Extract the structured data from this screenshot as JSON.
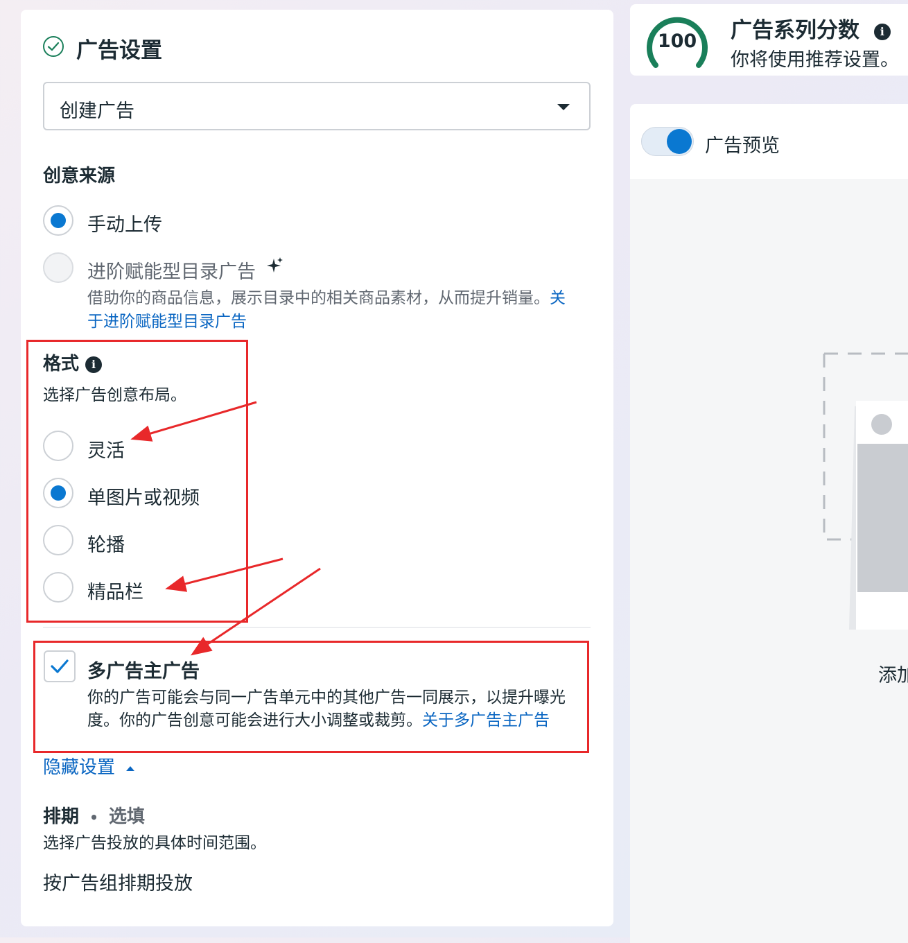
{
  "ad_settings": {
    "title": "广告设置",
    "create_select": {
      "value": "创建广告"
    },
    "creative_source": {
      "heading": "创意来源",
      "options": [
        {
          "label": "手动上传",
          "checked": true
        },
        {
          "label": "进阶赋能型目录广告",
          "checked": false,
          "description": "借助你的商品信息，展示目录中的相关商品素材，从而提升销量。",
          "link_line1": "关",
          "link_line2": "于进阶赋能型目录广告"
        }
      ]
    },
    "format": {
      "heading": "格式",
      "subtitle": "选择广告创意布局。",
      "options": [
        {
          "label": "灵活",
          "checked": false
        },
        {
          "label": "单图片或视频",
          "checked": true
        },
        {
          "label": "轮播",
          "checked": false
        },
        {
          "label": "精品栏",
          "checked": false
        }
      ]
    },
    "multi_advertiser": {
      "label": "多广告主广告",
      "checked": true,
      "desc_line1": "你的广告可能会与同一广告单元中的其他广告一同展示，以提升曝光",
      "desc_line2": "度。你的广告创意可能会进行大小调整或裁剪。",
      "link": "关于多广告主广告"
    },
    "hide_settings": "隐藏设置",
    "schedule": {
      "heading": "排期",
      "optional": "选填",
      "description": "选择广告投放的具体时间范围。",
      "option": "按广告组排期投放"
    }
  },
  "campaign_score": {
    "score": "100",
    "title": "广告系列分数",
    "subtitle": "你将使用推荐设置。"
  },
  "preview": {
    "label": "广告预览",
    "enabled": true,
    "add_text": "添加"
  },
  "colors": {
    "accent": "#0a78d1",
    "link": "#0a66c2",
    "score_ring": "#1a7f5a",
    "annotation": "#e8282a"
  }
}
